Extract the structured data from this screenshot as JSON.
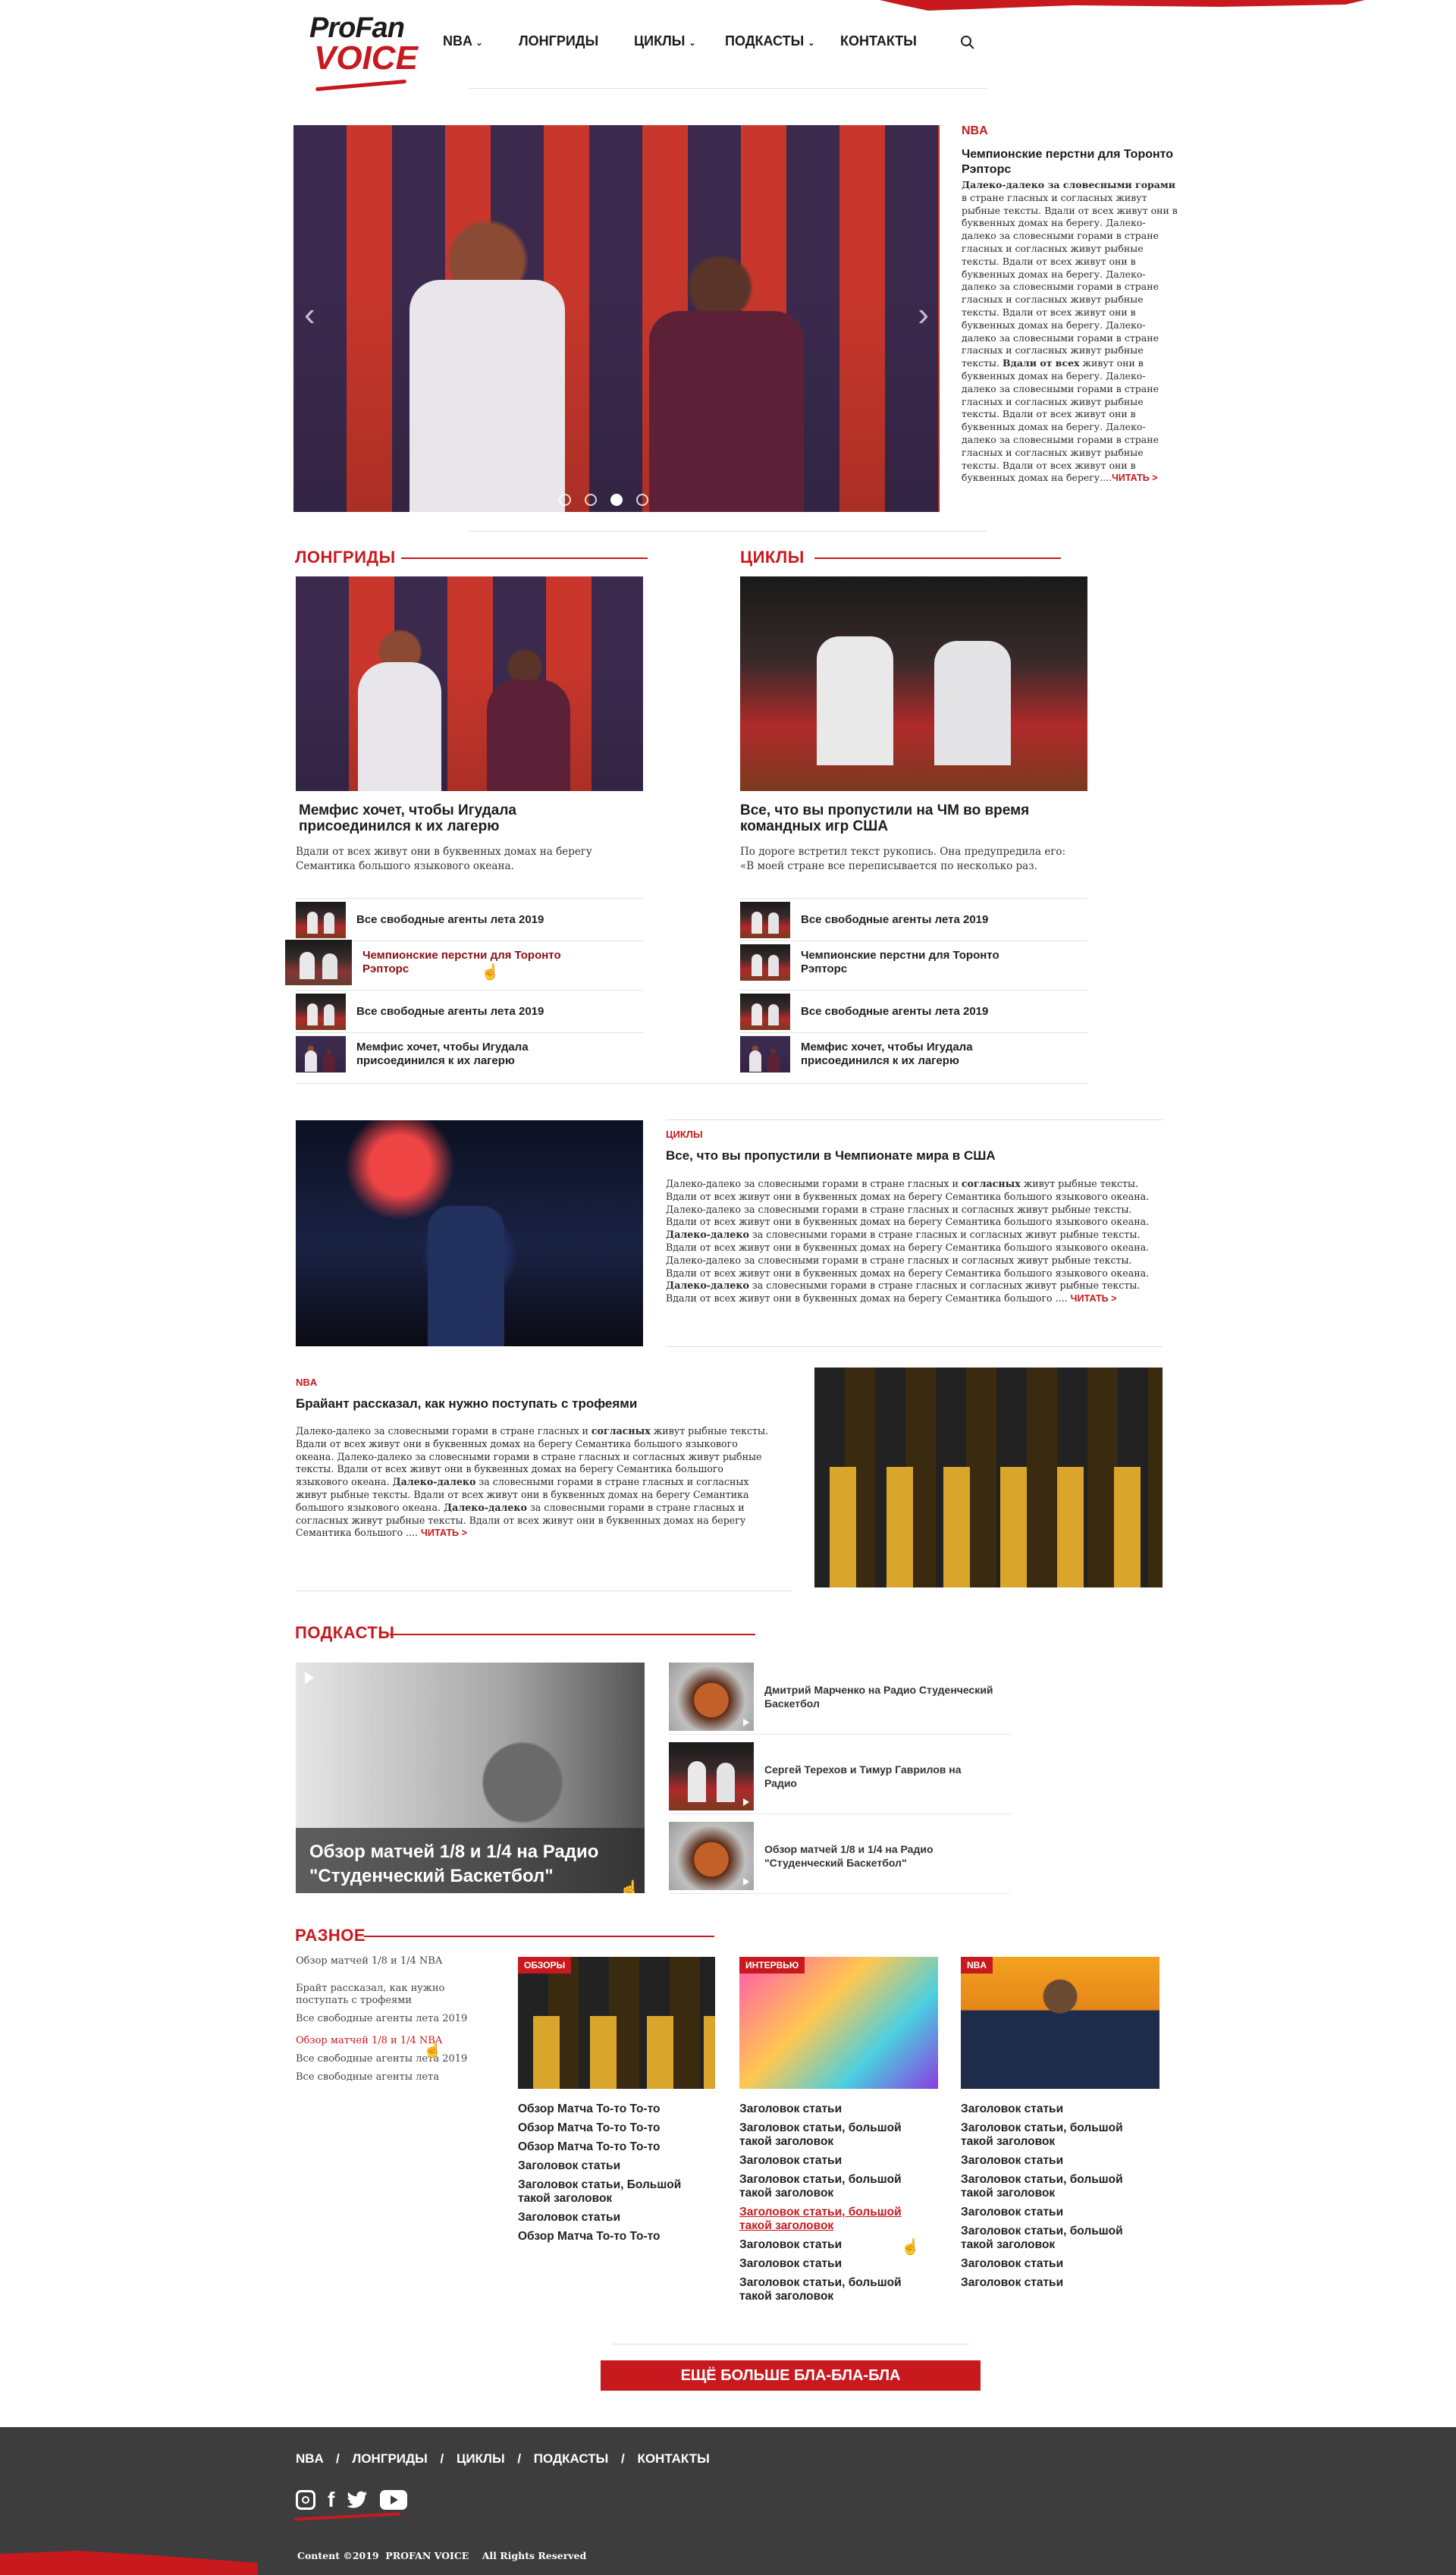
{
  "logo": {
    "line1": "ProFan",
    "line2": "VOICE"
  },
  "nav": {
    "items": [
      {
        "label": "NBA",
        "dropdown": true
      },
      {
        "label": "ЛОНГРИДЫ",
        "dropdown": false
      },
      {
        "label": "ЦИКЛЫ",
        "dropdown": true
      },
      {
        "label": "ПОДКАСТЫ",
        "dropdown": true
      },
      {
        "label": "КОНТАКТЫ",
        "dropdown": false
      }
    ]
  },
  "hero": {
    "tag": "NBA",
    "title": "Чемпионские перстни для Торонто Рэпторс",
    "text_parts": [
      {
        "t": "Далеко-далеко за словесными горами",
        "b": true
      },
      {
        "t": " в стране гласных и согласных живут рыбные тексты. Вдали от всех живут они в буквенных домах на берегу. Далеко-далеко за словесными горами в стране гласных и согласных живут рыбные тексты. Вдали от всех живут они в буквенных домах на берегу. Далеко-далеко за словесными горами в стране гласных и согласных живут рыбные тексты. Вдали от всех живут они в буквенных домах на берегу. Далеко-далеко за словесными горами в стране гласных и согласных живут рыбные тексты. ",
        "b": false
      },
      {
        "t": "Вдали от всех",
        "b": true
      },
      {
        "t": " живут они в буквенных домах на берегу. Далеко-далеко за словесными горами в стране гласных и согласных живут рыбные тексты. Вдали от всех живут они в буквенных домах на берегу. Далеко-далеко за словесными горами в стране гласных и согласных живут рыбные тексты. Вдали от всех живут они в буквенных домах на берегу....",
        "b": false
      }
    ],
    "read_more": "ЧИТАТЬ >",
    "slides": 5,
    "active_slide": 3
  },
  "longreads": {
    "heading": "ЛОНГРИДЫ",
    "feature_title": "Мемфис хочет, чтобы Игудала присоединился к их лагерю",
    "feature_text": "Вдали от всех живут они в буквенных домах на берегу Семантика большого языкового океана.",
    "list": [
      {
        "label": "Все свободные агенты лета 2019",
        "active": false
      },
      {
        "label": "Чемпионские перстни для Торонто Рэпторс",
        "active": true
      },
      {
        "label": "Все свободные агенты лета 2019",
        "active": false
      },
      {
        "label": "Мемфис хочет, чтобы Игудала присоединился к их лагерю",
        "active": false
      }
    ]
  },
  "cycles": {
    "heading": "ЦИКЛЫ",
    "feature_title": "Все, что вы пропустили на  ЧМ во время командных игр США",
    "feature_text": "По дороге встретил текст рукопись.  Она предупредила его: «В моей стране все переписывается  по несколько раз.",
    "list": [
      {
        "label": "Все свободные агенты лета 2019"
      },
      {
        "label": "Чемпионские перстни для Торонто Рэпторс"
      },
      {
        "label": "Все свободные агенты лета 2019"
      },
      {
        "label": "Мемфис хочет, чтобы Игудала присоединился к их лагерю"
      }
    ]
  },
  "article1": {
    "tag": "ЦИКЛЫ",
    "title": "Все, что вы пропустили в Чемпионате мира в США",
    "text_parts": [
      {
        "t": "Далеко-далеко за словесными горами в стране гласных и ",
        "b": false
      },
      {
        "t": "согласных",
        "b": true
      },
      {
        "t": " живут рыбные тексты. Вдали от всех живут они в буквенных домах на берегу Семантика большого языкового океана. Далеко-далеко за словесными горами в стране гласных и согласных живут рыбные тексты. Вдали от всех живут они в буквенных домах на берегу Семантика большого языкового океана. ",
        "b": false
      },
      {
        "t": "Далеко-далеко",
        "b": true
      },
      {
        "t": " за словесными горами в стране гласных и согласных живут рыбные тексты. Вдали от всех живут они в буквенных домах на берегу Семантика большого языкового океана. Далеко-далеко за словесными горами в стране гласных и согласных живут рыбные тексты. Вдали от всех живут они в буквенных домах на берегу Семантика большого языкового океана. ",
        "b": false
      },
      {
        "t": "Далеко-далеко",
        "b": true
      },
      {
        "t": " за словесными горами в стране гласных и согласных живут рыбные тексты. Вдали от всех живут они в буквенных домах на берегу Семантика большого .... ",
        "b": false
      }
    ],
    "read_more": "ЧИТАТЬ >"
  },
  "article2": {
    "tag": "NBA",
    "title": "Брайант рассказал, как нужно поступать с трофеями",
    "text_parts": [
      {
        "t": "Далеко-далеко за словесными горами в стране гласных и ",
        "b": false
      },
      {
        "t": "согласных",
        "b": true
      },
      {
        "t": " живут рыбные тексты. Вдали от всех живут они в буквенных домах на берегу Семантика большого языкового океана. Далеко-далеко за словесными горами в стране гласных и согласных живут рыбные тексты. Вдали от всех живут они в буквенных домах на берегу Семантика большого языкового океана. ",
        "b": false
      },
      {
        "t": "Далеко-далеко",
        "b": true
      },
      {
        "t": " за словесными горами в стране гласных и согласных живут рыбные тексты. Вдали от всех живут они в буквенных домах на берегу Семантика большого языкового океана. ",
        "b": false
      },
      {
        "t": "Далеко-далеко",
        "b": true
      },
      {
        "t": " за словесными горами в стране гласных и согласных живут рыбные тексты. Вдали от всех живут они в буквенных домах на берегу Семантика большого .... ",
        "b": false
      }
    ],
    "read_more": "ЧИТАТЬ >"
  },
  "podcasts": {
    "heading": "ПОДКАСТЫ",
    "feature_title": "Обзор матчей 1/8 и 1/4 на Радио \"Студенческий  Баскетбол\"",
    "list": [
      {
        "label": "Дмитрий Марченко на Радио Студенческий Баскетбол"
      },
      {
        "label": "Сергей Терехов и Тимур Гаврилов на Радио"
      },
      {
        "label": "Обзор матчей 1/8 и 1/4 на Радио \"Студенческий Баскетбол\""
      }
    ]
  },
  "misc": {
    "heading": "РАЗНОЕ",
    "links": [
      {
        "label": "Обзор матчей 1/8 и 1/4 NBA",
        "active": false
      },
      {
        "label": "Брайт рассказал, как нужно поступать с трофеями",
        "active": false
      },
      {
        "label": "Все свободные агенты лета 2019",
        "active": false
      },
      {
        "label": "Обзор матчей 1/8 и 1/4 NBA",
        "active": true
      },
      {
        "label": "Все свободные агенты лета 2019",
        "active": false
      },
      {
        "label": "Все свободные агенты лета",
        "active": false
      }
    ],
    "columns": [
      {
        "badge": "ОБЗОРЫ",
        "items": [
          {
            "label": "Обзор Матча То-то То-то",
            "active": false
          },
          {
            "label": "Обзор Матча То-то То-то",
            "active": false
          },
          {
            "label": "Обзор Матча То-то То-то",
            "active": false
          },
          {
            "label": "Заголовок статьи",
            "active": false
          },
          {
            "label": "Заголовок статьи, Большой такой заголовок",
            "active": false
          },
          {
            "label": "Заголовок статьи",
            "active": false
          },
          {
            "label": "Обзор Матча То-то То-то",
            "active": false
          }
        ]
      },
      {
        "badge": "ИНТЕРВЬЮ",
        "items": [
          {
            "label": "Заголовок статьи",
            "active": false
          },
          {
            "label": "Заголовок статьи, большой такой заголовок",
            "active": false
          },
          {
            "label": "Заголовок статьи",
            "active": false
          },
          {
            "label": "Заголовок статьи, большой такой заголовок",
            "active": false
          },
          {
            "label": "Заголовок статьи, большой такой заголовок",
            "active": true
          },
          {
            "label": "Заголовок статьи",
            "active": false
          },
          {
            "label": "Заголовок статьи",
            "active": false
          },
          {
            "label": "Заголовок статьи, большой такой заголовок",
            "active": false
          }
        ]
      },
      {
        "badge": "NBA",
        "items": [
          {
            "label": "Заголовок статьи",
            "active": false
          },
          {
            "label": "Заголовок статьи, большой такой заголовок",
            "active": false
          },
          {
            "label": "Заголовок статьи",
            "active": false
          },
          {
            "label": "Заголовок статьи, большой такой заголовок",
            "active": false
          },
          {
            "label": "Заголовок статьи",
            "active": false
          },
          {
            "label": "Заголовок статьи, большой такой заголовок",
            "active": false
          },
          {
            "label": "Заголовок статьи",
            "active": false
          },
          {
            "label": "Заголовок статьи",
            "active": false
          }
        ]
      }
    ]
  },
  "more_button": "ЕЩЁ БОЛЬШЕ БЛА-БЛА-БЛА",
  "footer": {
    "nav": [
      "NBA",
      "ЛОНГРИДЫ",
      "ЦИКЛЫ",
      "ПОДКАСТЫ",
      "КОНТАКТЫ"
    ],
    "separator": "/",
    "copyright": "Content ©2019  PROFAN VOICE    All Rights Reserved"
  },
  "colors": {
    "accent": "#c8191e",
    "footer_bg": "#3d3d3d"
  }
}
